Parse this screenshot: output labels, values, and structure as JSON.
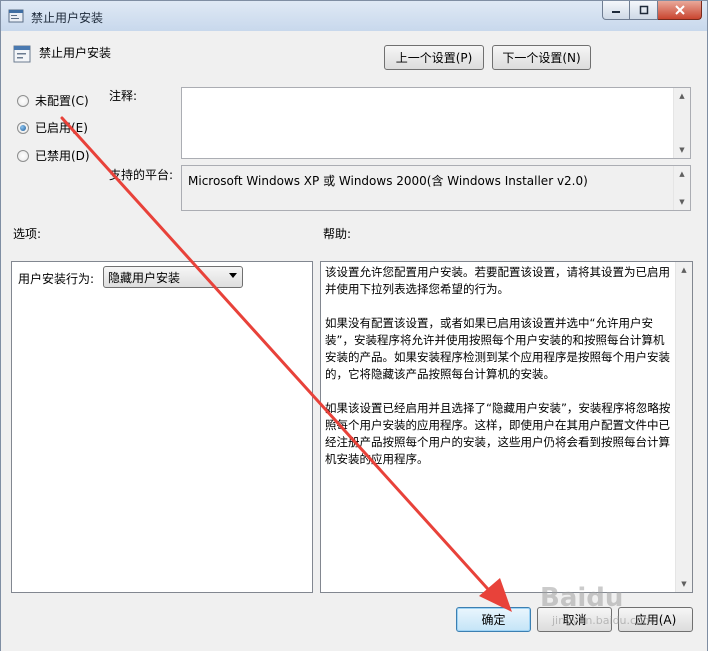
{
  "window": {
    "title": "禁止用户安装",
    "controls": {
      "minimize": "–",
      "maximize": "□",
      "close": "✕"
    }
  },
  "header": {
    "policy_name": "禁止用户安装",
    "prev_button": "上一个设置(P)",
    "next_button": "下一个设置(N)"
  },
  "state": {
    "options": [
      {
        "label": "未配置(C)",
        "checked": false
      },
      {
        "label": "已启用(E)",
        "checked": true
      },
      {
        "label": "已禁用(D)",
        "checked": false
      }
    ]
  },
  "comment": {
    "label": "注释:",
    "value": ""
  },
  "platform": {
    "label": "支持的平台:",
    "value": "Microsoft Windows XP 或 Windows 2000(含 Windows Installer v2.0)"
  },
  "options_pane": {
    "label": "选项:",
    "behavior_label": "用户安装行为:",
    "behavior_value": "隐藏用户安装"
  },
  "help_pane": {
    "label": "帮助:",
    "paragraphs": [
      "该设置允许您配置用户安装。若要配置该设置，请将其设置为已启用并使用下拉列表选择您希望的行为。",
      "如果没有配置该设置，或者如果已启用该设置并选中“允许用户安装”，安装程序将允许并使用按照每个用户安装的和按照每台计算机安装的产品。如果安装程序检测到某个应用程序是按照每个用户安装的，它将隐藏该产品按照每台计算机的安装。",
      "如果该设置已经启用并且选择了“隐藏用户安装”，安装程序将忽略按照每个用户安装的应用程序。这样，即使用户在其用户配置文件中已经注册产品按照每个用户的安装，这些用户仍将会看到按照每台计算机安装的应用程序。"
    ]
  },
  "footer": {
    "ok_button": "确定",
    "cancel_button": "取消",
    "apply_button": "应用(A)"
  },
  "watermark": {
    "text": "Baidu",
    "sub": "jingyan.baidu.com"
  },
  "colors": {
    "annotation_arrow": "#e8423a",
    "accent": "#3c7fb1"
  }
}
